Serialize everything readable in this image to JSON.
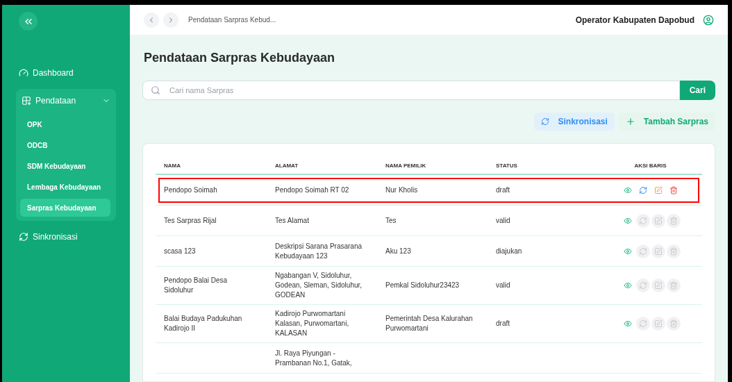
{
  "sidebar": {
    "items": [
      {
        "label": "Dashboard",
        "kind": "link"
      },
      {
        "label": "Pendataan",
        "kind": "group",
        "expanded": true,
        "children": [
          {
            "label": "OPK",
            "selected": false
          },
          {
            "label": "ODCB",
            "selected": false
          },
          {
            "label": "SDM Kebudayaan",
            "selected": false
          },
          {
            "label": "Lembaga Kebudayaan",
            "selected": false
          },
          {
            "label": "Sarpras Kebudayaan",
            "selected": true
          }
        ]
      },
      {
        "label": "Sinkronisasi",
        "kind": "sync"
      }
    ]
  },
  "topbar": {
    "breadcrumb": "Pendataan Sarpras Kebud...",
    "user": "Operator Kabupaten Dapobud"
  },
  "page_title": "Pendataan Sarpras Kebudayaan",
  "search": {
    "placeholder": "Cari nama Sarpras",
    "button": "Cari"
  },
  "actions": [
    {
      "label": "Sinkronisasi",
      "kind": "sync"
    },
    {
      "label": "Tambah Sarpras",
      "kind": "add"
    }
  ],
  "table": {
    "columns": [
      "NAMA",
      "ALAMAT",
      "NAMA PEMILIK",
      "STATUS",
      "AKSI BARIS"
    ],
    "rows": [
      {
        "cells": [
          "Pendopo Soimah",
          "Pendopo Soimah RT 02",
          "Nur Kholis",
          "draft"
        ],
        "highlighted": true,
        "actions_enabled": true
      },
      {
        "cells": [
          "Tes Sarpras Rijal",
          "Tes Alamat",
          "Tes",
          "valid"
        ],
        "highlighted": false,
        "actions_enabled": false
      },
      {
        "cells": [
          "scasa 123",
          "Deskripsi Sarana Prasarana Kebudayaan 123",
          "Aku 123",
          "diajukan"
        ],
        "highlighted": false,
        "actions_enabled": false
      },
      {
        "cells": [
          "Pendopo Balai Desa Sidoluhur",
          "Ngabangan V, Sidoluhur, Godean, Sleman, Sidoluhur, GODEAN",
          "Pemkal Sidoluhur23423",
          "valid"
        ],
        "highlighted": false,
        "actions_enabled": false
      },
      {
        "cells": [
          "Balai Budaya Padukuhan Kadirojo II",
          "Kadirojo Purwomartani Kalasan, Purwomartani, KALASAN",
          "Pemerintah Desa Kalurahan Purwomartani",
          "draft"
        ],
        "highlighted": false,
        "actions_enabled": false
      },
      {
        "cells": [
          "",
          "Jl. Raya Piyungan - Prambanan No.1, Gatak,",
          "",
          ""
        ],
        "highlighted": false,
        "actions_enabled": null
      }
    ]
  }
}
